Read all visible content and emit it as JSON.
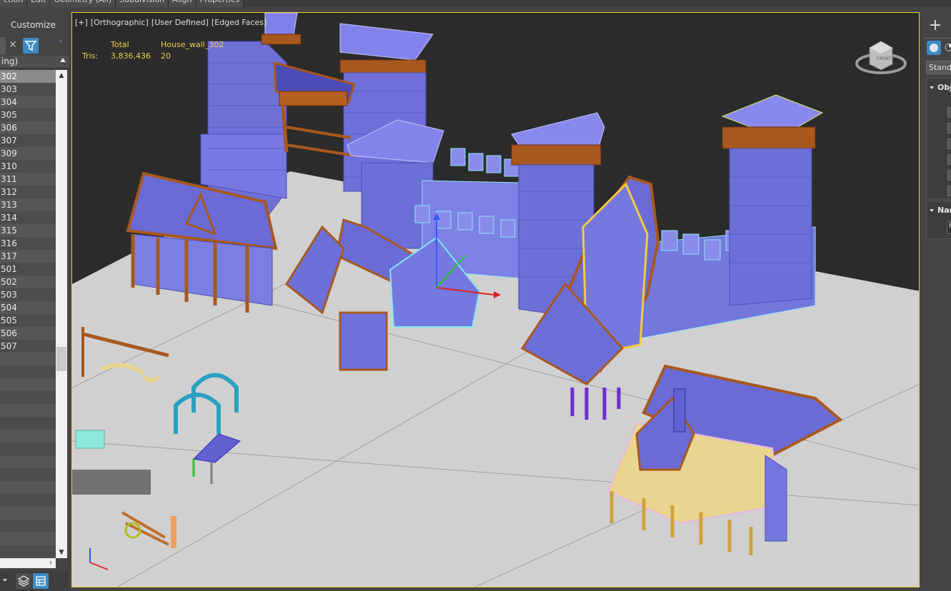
{
  "menu": {
    "tabs": [
      "ction",
      "Edit",
      "Geometry (All)",
      "Subdivision",
      "Align",
      "Properties"
    ]
  },
  "scene_explorer": {
    "customize_label": "Customize",
    "sort_header": "ing)",
    "items": [
      {
        "label": "302",
        "selected": true
      },
      {
        "label": "303"
      },
      {
        "label": "304"
      },
      {
        "label": "305"
      },
      {
        "label": "306"
      },
      {
        "label": "307"
      },
      {
        "label": "309"
      },
      {
        "label": "310"
      },
      {
        "label": "311"
      },
      {
        "label": "312"
      },
      {
        "label": "313"
      },
      {
        "label": "314"
      },
      {
        "label": "315"
      },
      {
        "label": "316"
      },
      {
        "label": "317"
      },
      {
        "label": "501"
      },
      {
        "label": "502"
      },
      {
        "label": "503"
      },
      {
        "label": "504"
      },
      {
        "label": "505"
      },
      {
        "label": "506"
      },
      {
        "label": "507"
      }
    ],
    "empty_rows": 16
  },
  "viewport": {
    "label_tokens": [
      "[+]",
      "[Orthographic]",
      "[User Defined]",
      "[Edged Faces]"
    ],
    "stats": {
      "header_total": "Total",
      "header_object": "House_wall_302",
      "row_label": "Tris:",
      "total_value": "3,836,436",
      "object_value": "20"
    },
    "viewcube_label": "FRONT",
    "colors": {
      "background": "#2b2b2b",
      "ground": "#cfcfcf",
      "wall": "#7b7fe0",
      "wood": "#a8581e",
      "selection": "#f2cc3a",
      "highlight_cyan": "#7fe8f0"
    }
  },
  "command_panel": {
    "create_icon": "plus-icon",
    "dropdown_label": "Standa",
    "object_rollout_label": "Obj",
    "name_rollout_label": "Nar",
    "name_field_value": "H"
  }
}
